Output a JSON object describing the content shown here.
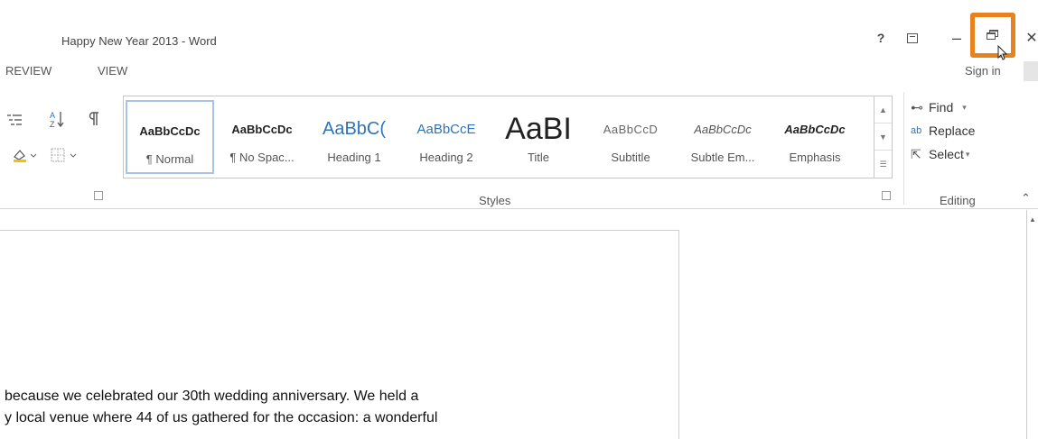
{
  "window": {
    "title": "Happy New Year 2013 - Word",
    "help_label": "?",
    "minimize_label": "–",
    "close_label": "✕"
  },
  "tabs": [
    {
      "label": "REVIEW"
    },
    {
      "label": "VIEW"
    }
  ],
  "account": {
    "sign_in_label": "Sign in"
  },
  "styles": {
    "group_label": "Styles",
    "items": [
      {
        "preview": "AaBbCcDc",
        "label": "¶ Normal"
      },
      {
        "preview": "AaBbCcDc",
        "label": "¶ No Spac..."
      },
      {
        "preview": "AaBbC(",
        "label": "Heading 1"
      },
      {
        "preview": "AaBbCcE",
        "label": "Heading 2"
      },
      {
        "preview": "AaBI",
        "label": "Title"
      },
      {
        "preview": "AaBbCcD",
        "label": "Subtitle"
      },
      {
        "preview": "AaBbCcDc",
        "label": "Subtle Em..."
      },
      {
        "preview": "AaBbCcDc",
        "label": "Emphasis"
      }
    ]
  },
  "editing": {
    "group_label": "Editing",
    "find_label": "Find",
    "replace_label": "Replace",
    "select_label": "Select"
  },
  "document": {
    "lines": [
      "because we celebrated our 30th wedding anniversary. We held a",
      "y local venue where 44 of us gathered for the occasion: a wonderful"
    ]
  },
  "colors": {
    "highlight": "#e8821f",
    "heading_blue": "#2e74b5"
  }
}
